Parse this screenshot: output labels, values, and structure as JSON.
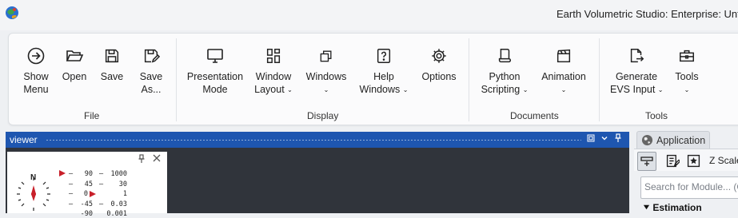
{
  "window": {
    "title": "Earth Volumetric Studio: Enterprise: Untitled"
  },
  "ribbon": {
    "groups": {
      "file": "File",
      "display": "Display",
      "documents": "Documents",
      "tools": "Tools"
    },
    "buttons": {
      "show_menu": [
        "Show",
        "Menu"
      ],
      "open": "Open",
      "save": "Save",
      "save_as": [
        "Save",
        "As..."
      ],
      "presentation_mode": [
        "Presentation",
        "Mode"
      ],
      "window_layout": [
        "Window",
        "Layout"
      ],
      "windows": "Windows",
      "help_windows": [
        "Help",
        "Windows"
      ],
      "options": "Options",
      "python_scripting": [
        "Python",
        "Scripting"
      ],
      "animation": "Animation",
      "generate_evs_input": [
        "Generate",
        "EVS Input"
      ],
      "tools": "Tools"
    },
    "dropdown_chevron": "⌄"
  },
  "viewer": {
    "title": "viewer",
    "compass_north": "N",
    "scale_left": [
      "90",
      "45",
      "0",
      "-45",
      "-90"
    ],
    "scale_right": [
      "1000",
      "30",
      "1",
      "0.03",
      "0.001"
    ]
  },
  "application_panel": {
    "tab_label": "Application",
    "z_scale_label": "Z Scale",
    "search_placeholder": "Search for Module... (Ctrl+E)",
    "section": "Estimation"
  },
  "colors": {
    "viewer_bar": "#1e56b0",
    "viewer_bg": "#30343b",
    "marker_red": "#c8202a"
  }
}
